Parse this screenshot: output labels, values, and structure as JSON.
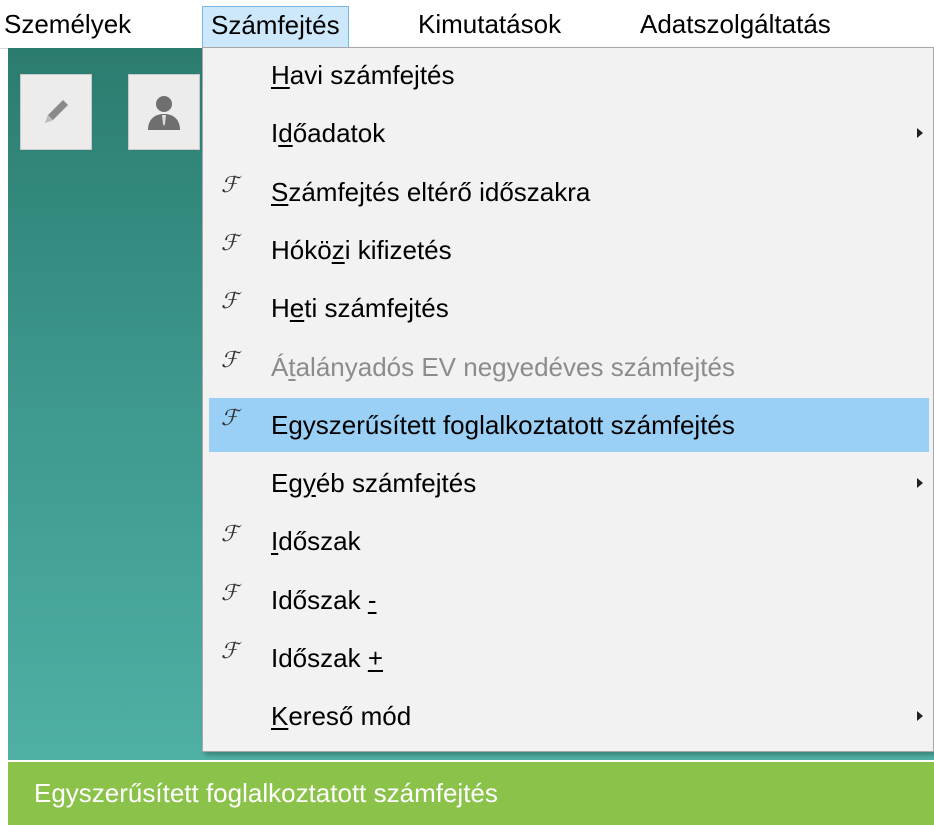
{
  "menubar": {
    "items": [
      {
        "label": "Személyek"
      },
      {
        "label": "Számfejtés"
      },
      {
        "label": "Kimutatások"
      },
      {
        "label": "Adatszolgáltatás"
      }
    ]
  },
  "toolbar": {
    "tiles": [
      {
        "icon": "pencil-icon"
      },
      {
        "icon": "person-icon"
      }
    ]
  },
  "dropdown": {
    "items": [
      {
        "pre": "",
        "key": "H",
        "post": "avi számfejtés",
        "fx": false,
        "submenu": false,
        "disabled": false,
        "highlighted": false
      },
      {
        "pre": "I",
        "key": "d",
        "post": "őadatok",
        "fx": false,
        "submenu": true,
        "disabled": false,
        "highlighted": false
      },
      {
        "pre": "",
        "key": "S",
        "post": "zámfejtés eltérő időszakra",
        "fx": true,
        "submenu": false,
        "disabled": false,
        "highlighted": false
      },
      {
        "pre": "Hókö",
        "key": "z",
        "post": "i kifizetés",
        "fx": true,
        "submenu": false,
        "disabled": false,
        "highlighted": false
      },
      {
        "pre": "H",
        "key": "e",
        "post": "ti számfejtés",
        "fx": true,
        "submenu": false,
        "disabled": false,
        "highlighted": false
      },
      {
        "pre": "Á",
        "key": "t",
        "post": "alányadós EV negyedéves számfejtés",
        "fx": true,
        "submenu": false,
        "disabled": true,
        "highlighted": false
      },
      {
        "pre": "Egyszerűsített foglalkoztatott számfejtés",
        "key": "",
        "post": "",
        "fx": true,
        "submenu": false,
        "disabled": false,
        "highlighted": true
      },
      {
        "pre": "Eg",
        "key": "y",
        "post": "éb számfejtés",
        "fx": false,
        "submenu": true,
        "disabled": false,
        "highlighted": false
      },
      {
        "pre": "",
        "key": "I",
        "post": "dőszak",
        "fx": true,
        "submenu": false,
        "disabled": false,
        "highlighted": false
      },
      {
        "pre": "Időszak ",
        "key": "-",
        "post": "",
        "fx": true,
        "submenu": false,
        "disabled": false,
        "highlighted": false
      },
      {
        "pre": "Időszak ",
        "key": "+",
        "post": "",
        "fx": true,
        "submenu": false,
        "disabled": false,
        "highlighted": false
      },
      {
        "pre": "",
        "key": "K",
        "post": "ereső mód",
        "fx": false,
        "submenu": true,
        "disabled": false,
        "highlighted": false
      }
    ]
  },
  "statusbar": {
    "text": "Egyszerűsített foglalkoztatott számfejtés"
  },
  "colors": {
    "menu_active_bg": "#cde8fb",
    "menu_highlight_bg": "#9bd0f6",
    "statusbar_bg": "#8bc34a",
    "workspace_teal": "#3c968b"
  }
}
